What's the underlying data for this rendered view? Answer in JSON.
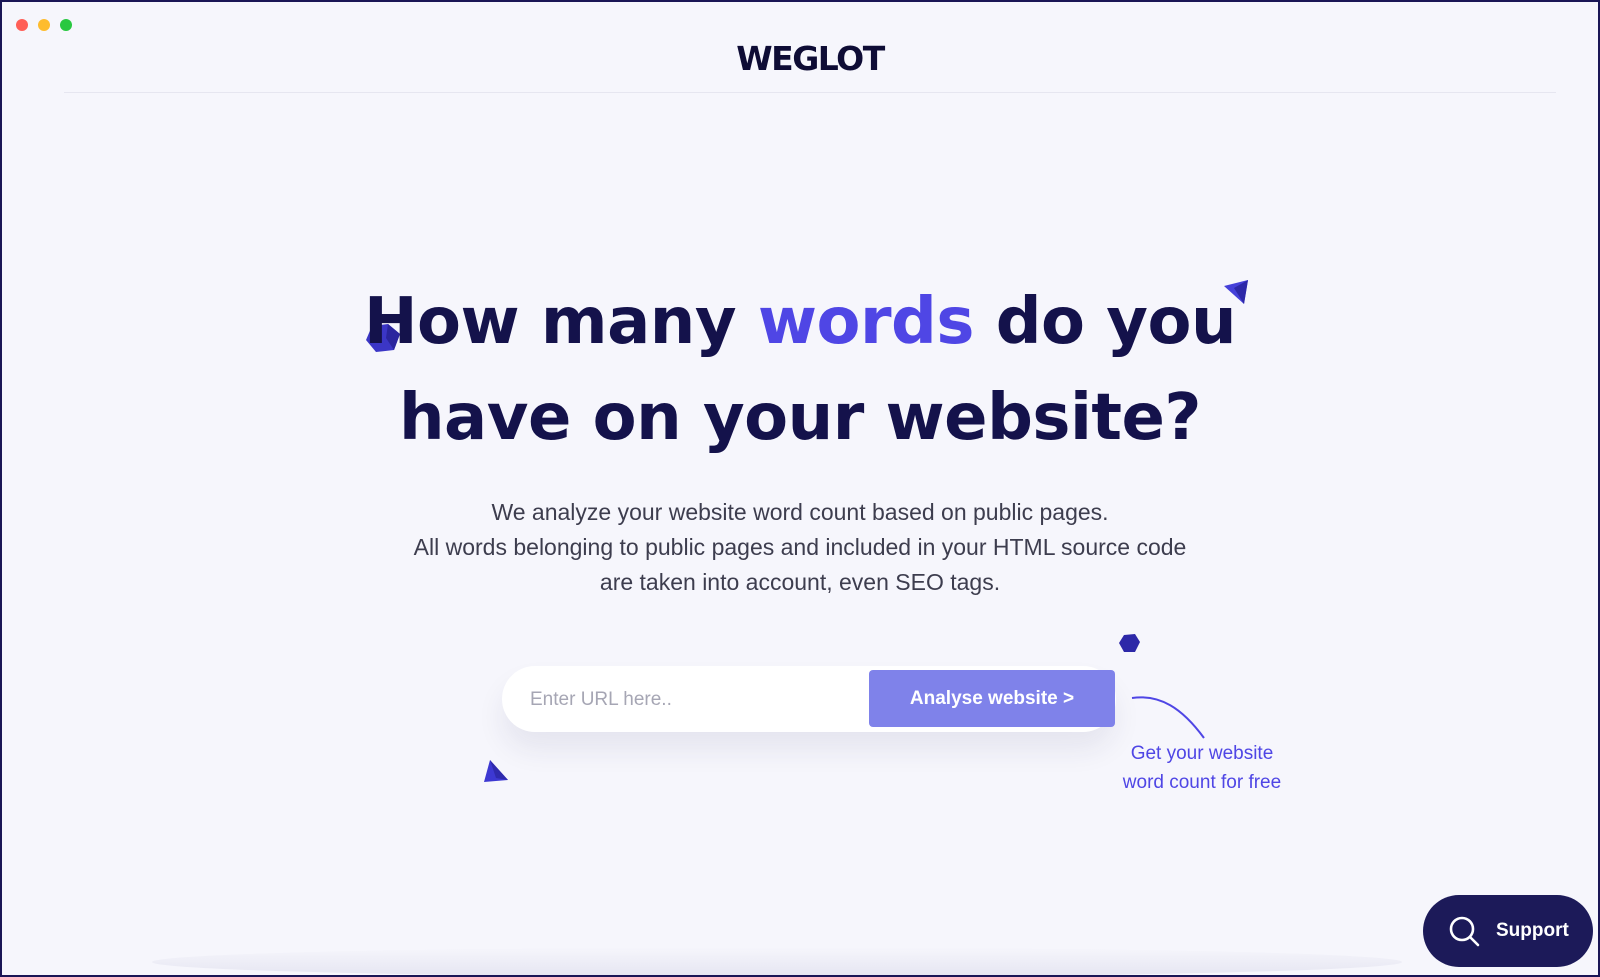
{
  "window": {
    "controls": {
      "close": "#ff5f57",
      "minimize": "#febc2e",
      "maximize": "#28c840"
    }
  },
  "header": {
    "logo": "WEGLOT"
  },
  "hero": {
    "title_part1": "How many ",
    "title_accent": "words",
    "title_part2": " do you",
    "title_line2": "have on your website?",
    "desc_line1": "We analyze your website word count based on public pages.",
    "desc_line2": "All words belonging to public pages and included in your HTML source code",
    "desc_line3": "are taken into account, even SEO tags."
  },
  "form": {
    "url_value": "",
    "url_placeholder": "Enter URL here..",
    "submit_label": "Analyse website >"
  },
  "callout": {
    "line1": "Get your website",
    "line2": "word count for free"
  },
  "support": {
    "label": "Support",
    "icon": "search-icon"
  },
  "colors": {
    "accent": "#4f46e5",
    "navy": "#14124b",
    "button": "#7f82ea",
    "background": "#f6f6fc"
  }
}
